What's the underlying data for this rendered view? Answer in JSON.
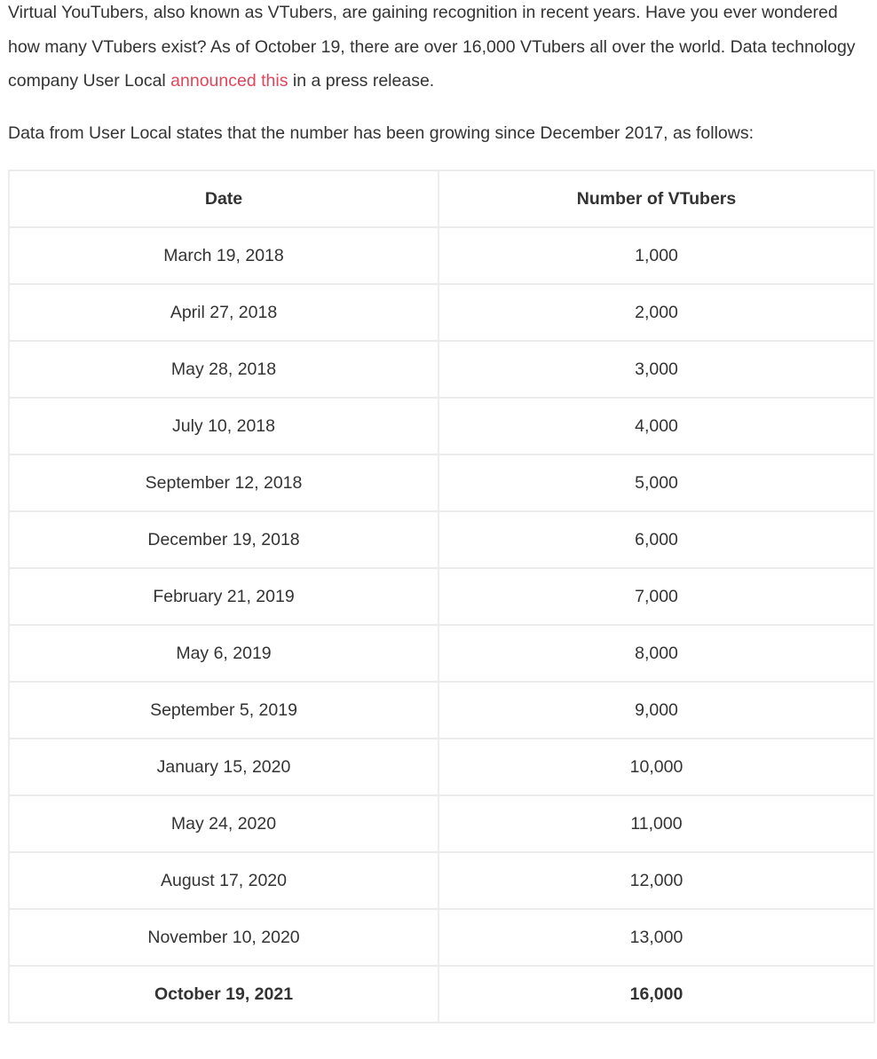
{
  "paragraph1": {
    "text_before": "Virtual YouTubers, also known as VTubers, are gaining recognition in recent years. Have you ever wondered how many VTubers exist? As of October 19, there are over 16,000 VTubers all over the world. Data technology company User Local ",
    "link_text": "announced this",
    "text_after": " in a press release."
  },
  "paragraph2": {
    "text": "Data from User Local states that the number has been growing since December 2017, as follows:"
  },
  "table": {
    "headers": [
      "Date",
      "Number of VTubers"
    ],
    "rows": [
      {
        "date": "March 19, 2018",
        "count": "1,000"
      },
      {
        "date": "April 27, 2018",
        "count": "2,000"
      },
      {
        "date": "May 28, 2018",
        "count": "3,000"
      },
      {
        "date": "July 10, 2018",
        "count": "4,000"
      },
      {
        "date": "September 12, 2018",
        "count": "5,000"
      },
      {
        "date": "December 19, 2018",
        "count": "6,000"
      },
      {
        "date": "February 21, 2019",
        "count": "7,000"
      },
      {
        "date": "May 6, 2019",
        "count": "8,000"
      },
      {
        "date": "September 5, 2019",
        "count": "9,000"
      },
      {
        "date": "January 15, 2020",
        "count": "10,000"
      },
      {
        "date": "May 24, 2020",
        "count": "11,000"
      },
      {
        "date": "August 17, 2020",
        "count": "12,000"
      },
      {
        "date": "November 10, 2020",
        "count": "13,000"
      },
      {
        "date": "October 19, 2021",
        "count": "16,000",
        "emphasized": true
      }
    ]
  },
  "colors": {
    "text": "#333333",
    "link": "#e0455a",
    "border": "#ececec"
  }
}
